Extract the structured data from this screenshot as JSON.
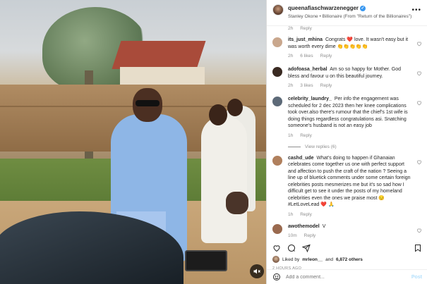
{
  "header": {
    "username": "queenafiaschwarzenegger",
    "subtitle": "Stanley Okone • Billionaire (From \"Return of the Billionaires\")"
  },
  "first_comment_meta": {
    "time": "2h",
    "replies": "Reply"
  },
  "comments": [
    {
      "user": "its_just_mhina",
      "text": "Congrats ❤️ love. It wasn't easy but it was worth every dime 👏👏👏👏👏",
      "time": "2h",
      "likes": "6 likes",
      "reply": "Reply",
      "avatar_color": "#c9a78d"
    },
    {
      "user": "adofoasa_herbal",
      "text": "Am so so happy for Mother. God bless and favour u on this beautiful journey.",
      "time": "2h",
      "likes": "3 likes",
      "reply": "Reply",
      "avatar_color": "#3a2a22"
    },
    {
      "user": "celebrity_laundry_",
      "text": "Per info the engagement was scheduled for 2 dec 2023 then her knee complications took over.also there's rumour that the chief's 1st wife is doing things regardless congratulations asi. Snatching someone's husband is not an easy job",
      "time": "1h",
      "likes": "",
      "reply": "Reply",
      "view_replies": "View replies (6)",
      "avatar_color": "#5d6a78"
    },
    {
      "user": "cashd_ude",
      "text": "What's doing to happen if Ghanaian celebrates come together us one with perfect support and affection to push the craft of the nation ? Seeing a line up of bluetick comments under some certain foreign celebrities posts mesmerizes me but it's so sad how I difficult get to see it under the posts of my homeland celebrities even the ones we praise most 😔 #LetLoveLead ❤️ 🙏",
      "time": "1h",
      "likes": "",
      "reply": "Reply",
      "avatar_color": "#b0805d"
    },
    {
      "user": "awothemodel",
      "text": "V",
      "time": "10m",
      "likes": "",
      "reply": "Reply",
      "avatar_color": "#9a6a4f"
    }
  ],
  "likes_line": {
    "prefix": "Liked by",
    "user": "mrleon__",
    "middle": "and",
    "others": "6,872 others"
  },
  "time_ago": "2 HOURS AGO",
  "add_comment": {
    "placeholder": "Add a comment...",
    "post_label": "Post"
  },
  "icons": {
    "more": "more-icon",
    "heart": "heart-icon",
    "comment": "comment-icon",
    "share": "share-icon",
    "bookmark": "bookmark-icon",
    "emoji": "emoji-icon",
    "volume": "volume-muted-icon"
  }
}
